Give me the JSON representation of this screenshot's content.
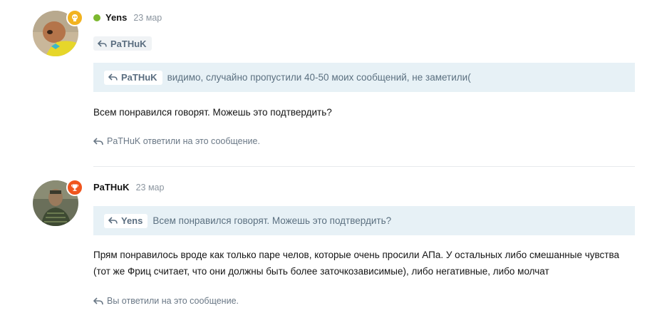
{
  "posts": [
    {
      "author": "Yens",
      "date": "23 мар",
      "online": true,
      "badge_icon": "skull-icon",
      "badge_color": "#f2b320",
      "mention_chip": "PaTHuK",
      "quote": {
        "author": "PaTHuK",
        "text": "видимо, случайно пропустили 40-50 моих сообщений, не заметили("
      },
      "text": "Всем понравился говорят. Можешь это подтвердить?",
      "replied_note": "PaTHuK ответили на это сообщение."
    },
    {
      "author": "PaTHuK",
      "date": "23 мар",
      "online": false,
      "badge_icon": "trophy-icon",
      "badge_color": "#f0551e",
      "quote": {
        "author": "Yens",
        "text": "Всем понравился говорят. Можешь это подтвердить?"
      },
      "text_lines": [
        "Прям понравилось вроде как только паре челов, которые очень просили АПа. У остальных либо смешанные чувства",
        "(тот же Фриц считает, что они должны быть более заточкозависимые), либо негативные, либо молчат"
      ],
      "replied_note": "Вы ответили на это сообщение."
    }
  ],
  "colors": {
    "online": "#7cb82f",
    "quote_bg": "#e7f1f6",
    "muted": "#8c96a0"
  }
}
